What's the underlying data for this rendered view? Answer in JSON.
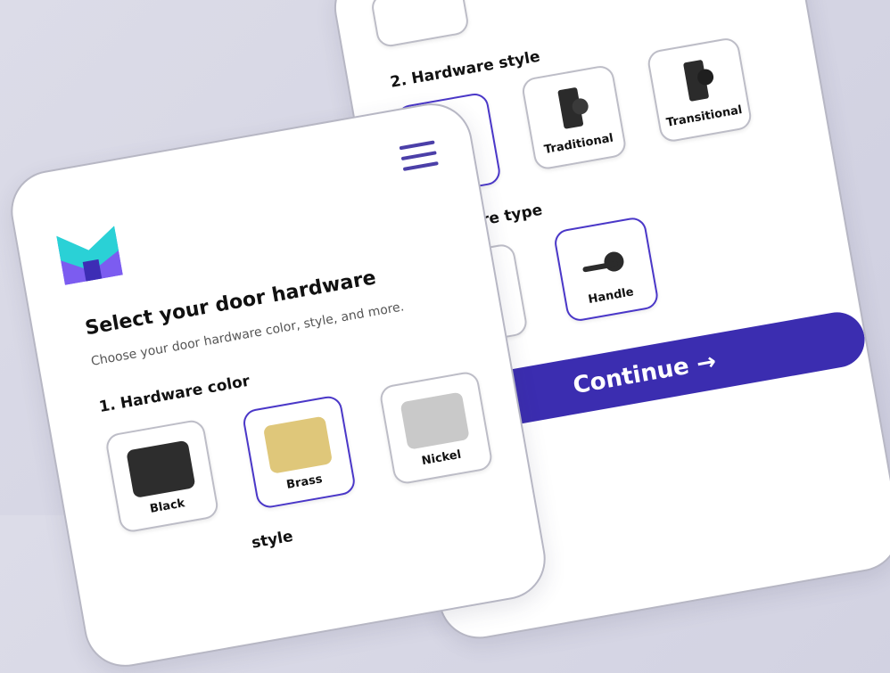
{
  "colors": {
    "accent": "#3b2db0",
    "selected_border": "#4a37c8",
    "menu": "#4b3fa8"
  },
  "back": {
    "section2": "2. Hardware style",
    "styles": [
      {
        "label": "Traditional",
        "icon": "traditional-lock-icon"
      },
      {
        "label": "Transitional",
        "icon": "transitional-lock-icon"
      }
    ],
    "section3": "re type",
    "types": [
      {
        "label": "Handle",
        "icon": "handle-lever-icon"
      }
    ],
    "continue": "Continue →"
  },
  "front": {
    "title": "Select your door hardware",
    "subtitle": "Choose your door hardware color, style, and more.",
    "section1": "1. Hardware color",
    "colors": [
      {
        "label": "Black",
        "swatch": "#2d2d2d"
      },
      {
        "label": "Brass",
        "swatch": "#dfc77a"
      },
      {
        "label": "Nickel",
        "swatch": "#c9c9c9"
      }
    ],
    "section2_partial": "style"
  }
}
